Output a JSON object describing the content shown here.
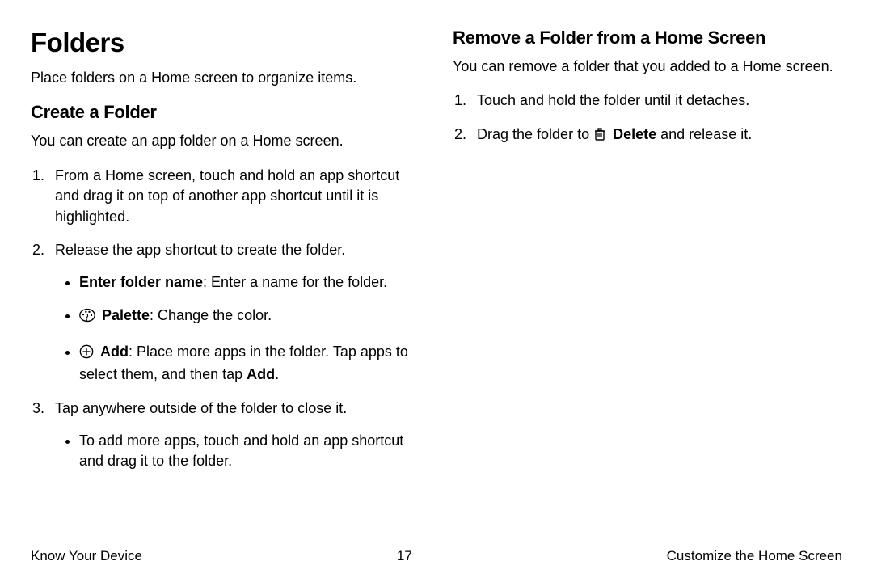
{
  "left": {
    "title": "Folders",
    "intro": "Place folders on a Home screen to organize items.",
    "create": {
      "heading": "Create a Folder",
      "desc": "You can create an app folder on a Home screen.",
      "step1": "From a Home screen, touch and hold an app shortcut and drag it on top of another app shortcut until it is highlighted.",
      "step2": "Release the app shortcut to create the folder.",
      "b1_bold": "Enter folder name",
      "b1_rest": ": Enter a name for the folder.",
      "b2_bold": "Palette",
      "b2_rest": ": Change the color.",
      "b3_bold": "Add",
      "b3_mid": ": Place more apps in the folder. Tap apps to select them, and then tap ",
      "b3_tail": "Add",
      "b3_period": ".",
      "step3": "Tap anywhere outside of the folder to close it.",
      "step3_sub": "To add more apps, touch and hold an app shortcut and drag it to the folder."
    }
  },
  "right": {
    "heading": "Remove a Folder from a Home Screen",
    "desc": "You can remove a folder that you added to a Home screen.",
    "step1": "Touch and hold the folder until it detaches.",
    "step2_pre": "Drag the folder to ",
    "step2_bold": "Delete",
    "step2_post": " and release it."
  },
  "footer": {
    "left": "Know Your Device",
    "center": "17",
    "right": "Customize the Home Screen"
  }
}
